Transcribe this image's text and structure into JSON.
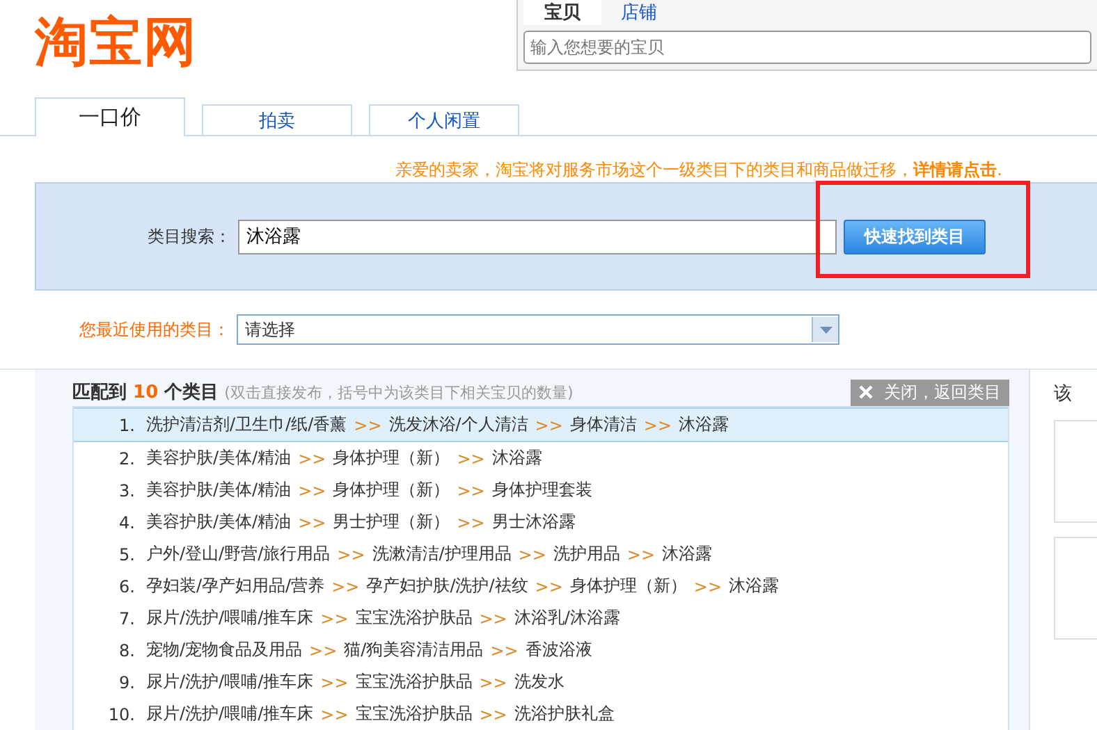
{
  "logo": {
    "text": "淘宝网"
  },
  "site_search": {
    "tabs": [
      {
        "label": "宝贝",
        "selected": true
      },
      {
        "label": "店铺",
        "selected": false
      }
    ],
    "placeholder": "输入您想要的宝贝"
  },
  "tabs": [
    {
      "label": "一口价",
      "selected": true
    },
    {
      "label": "拍卖",
      "selected": false
    },
    {
      "label": "个人闲置",
      "selected": false
    }
  ],
  "notice": "亲爱的卖家，淘宝将对服务市场这个一级类目下的类目和商品做迁移，**详情请点击**.",
  "category_search": {
    "label": "类目搜索：",
    "value": "沐浴露",
    "button": "快速找到类目"
  },
  "recent": {
    "label": "您最近使用的类目：",
    "value": "请选择"
  },
  "results": {
    "prefix": "匹配到",
    "count": "10",
    "suffix": "个类目",
    "hint": "(双击直接发布，括号中为该类目下相关宝贝的数量)",
    "close_button": "关闭，返回类目",
    "separator": ">>",
    "rows": [
      {
        "number": "1.",
        "path": [
          "洗护清洁剂/卫生巾/纸/香薰",
          "洗发沐浴/个人清洁",
          "身体清洁",
          "沐浴露"
        ],
        "selected": true
      },
      {
        "number": "2.",
        "path": [
          "美容护肤/美体/精油",
          "身体护理（新）",
          "沐浴露"
        ],
        "selected": false
      },
      {
        "number": "3.",
        "path": [
          "美容护肤/美体/精油",
          "身体护理（新）",
          "身体护理套装"
        ],
        "selected": false
      },
      {
        "number": "4.",
        "path": [
          "美容护肤/美体/精油",
          "男士护理（新）",
          "男士沐浴露"
        ],
        "selected": false
      },
      {
        "number": "5.",
        "path": [
          "户外/登山/野营/旅行用品",
          "洗漱清洁/护理用品",
          "洗护用品",
          "沐浴露"
        ],
        "selected": false
      },
      {
        "number": "6.",
        "path": [
          "孕妇装/孕产妇用品/营养",
          "孕产妇护肤/洗护/祛纹",
          "身体护理（新）",
          "沐浴露"
        ],
        "selected": false
      },
      {
        "number": "7.",
        "path": [
          "尿片/洗护/喂哺/推车床",
          "宝宝洗浴护肤品",
          "沐浴乳/沐浴露"
        ],
        "selected": false
      },
      {
        "number": "8.",
        "path": [
          "宠物/宠物食品及用品",
          "猫/狗美容清洁用品",
          "香波浴液"
        ],
        "selected": false
      },
      {
        "number": "9.",
        "path": [
          "尿片/洗护/喂哺/推车床",
          "宝宝洗浴护肤品",
          "洗发水"
        ],
        "selected": false
      },
      {
        "number": "10.",
        "path": [
          "尿片/洗护/喂哺/推车床",
          "宝宝洗浴护肤品",
          "洗浴护肤礼盒"
        ],
        "selected": false
      }
    ]
  },
  "side_panel": {
    "title": "该"
  }
}
